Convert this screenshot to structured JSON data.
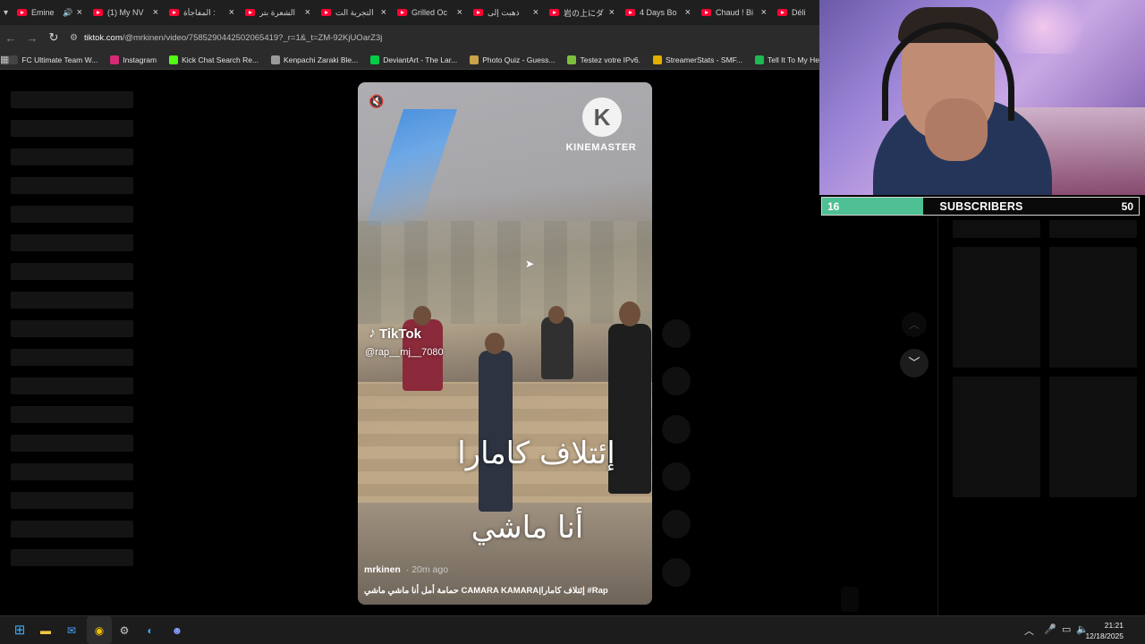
{
  "browser": {
    "tabs": [
      {
        "title": "Emine",
        "audio": true,
        "active": false
      },
      {
        "title": "(1) My NV",
        "audio": false,
        "active": false
      },
      {
        "title": "المفاجأة :",
        "audio": false,
        "active": false
      },
      {
        "title": "الشعرة بتر",
        "audio": false,
        "active": false
      },
      {
        "title": "التجربة الت",
        "audio": false,
        "active": false
      },
      {
        "title": "Grilled Oc",
        "audio": false,
        "active": false
      },
      {
        "title": "ذهبت إلى",
        "audio": false,
        "active": false
      },
      {
        "title": "岩の上にダ",
        "audio": false,
        "active": false
      },
      {
        "title": "4 Days Bo",
        "audio": false,
        "active": false
      },
      {
        "title": "Chaud ! Bi",
        "audio": false,
        "active": false
      },
      {
        "title": "Déli",
        "audio": false,
        "active": false
      }
    ],
    "url_domain": "tiktok.com",
    "url_path": "/@mrkinen/video/7585290442502065419?_r=1&_t=ZM-92KjUOarZ3j",
    "bookmarks": [
      {
        "label": "FC Ultimate Team W...",
        "color": "#444444"
      },
      {
        "label": "Instagram",
        "color": "#d62976"
      },
      {
        "label": "Kick Chat Search Re...",
        "color": "#53fc18"
      },
      {
        "label": "Kenpachi Zaraki Ble...",
        "color": "#9a9a9a"
      },
      {
        "label": "DeviantArt - The Lar...",
        "color": "#05cc47"
      },
      {
        "label": "Photo Quiz - Guess...",
        "color": "#c9a24a"
      },
      {
        "label": "Testez votre IPv6.",
        "color": "#7cbf3a"
      },
      {
        "label": "StreamerStats - SMF...",
        "color": "#e0b000"
      },
      {
        "label": "Tell It To My Heart -...",
        "color": "#1db954"
      }
    ]
  },
  "video": {
    "watermark": "KINEMASTER",
    "watermark_letter": "K",
    "tiktok_logo": "TikTok",
    "tiktok_handle": "@rap__mj__7080",
    "overlay_line1": "إئتلاف كامارا",
    "overlay_line2": "أنا ماشي",
    "author": "mrkinen",
    "time": "· 20m ago",
    "description": "حمامة أمل أنا ماشي ماشي CAMARA KAMARA|إئتلاف كامارا #Rap"
  },
  "stream": {
    "subscribers_current": "16",
    "subscribers_label": "SUBSCRIBERS",
    "subscribers_goal": "50",
    "progress_fraction": 0.32,
    "accent": "#4fbf94"
  },
  "taskbar": {
    "time": "21:21",
    "date": "12/18/2025"
  },
  "icons": [
    "tab-search-icon",
    "back-arrow-icon",
    "forward-arrow-icon",
    "reload-icon",
    "site-info-icon",
    "apps-icon",
    "mute-icon",
    "tiktok-icon",
    "chevron-up-icon",
    "chevron-down-icon",
    "windows-start-icon",
    "file-explorer-icon",
    "mail-icon",
    "chrome-icon",
    "settings-icon",
    "edge-icon",
    "discord-icon",
    "wifi-icon",
    "volume-icon"
  ]
}
